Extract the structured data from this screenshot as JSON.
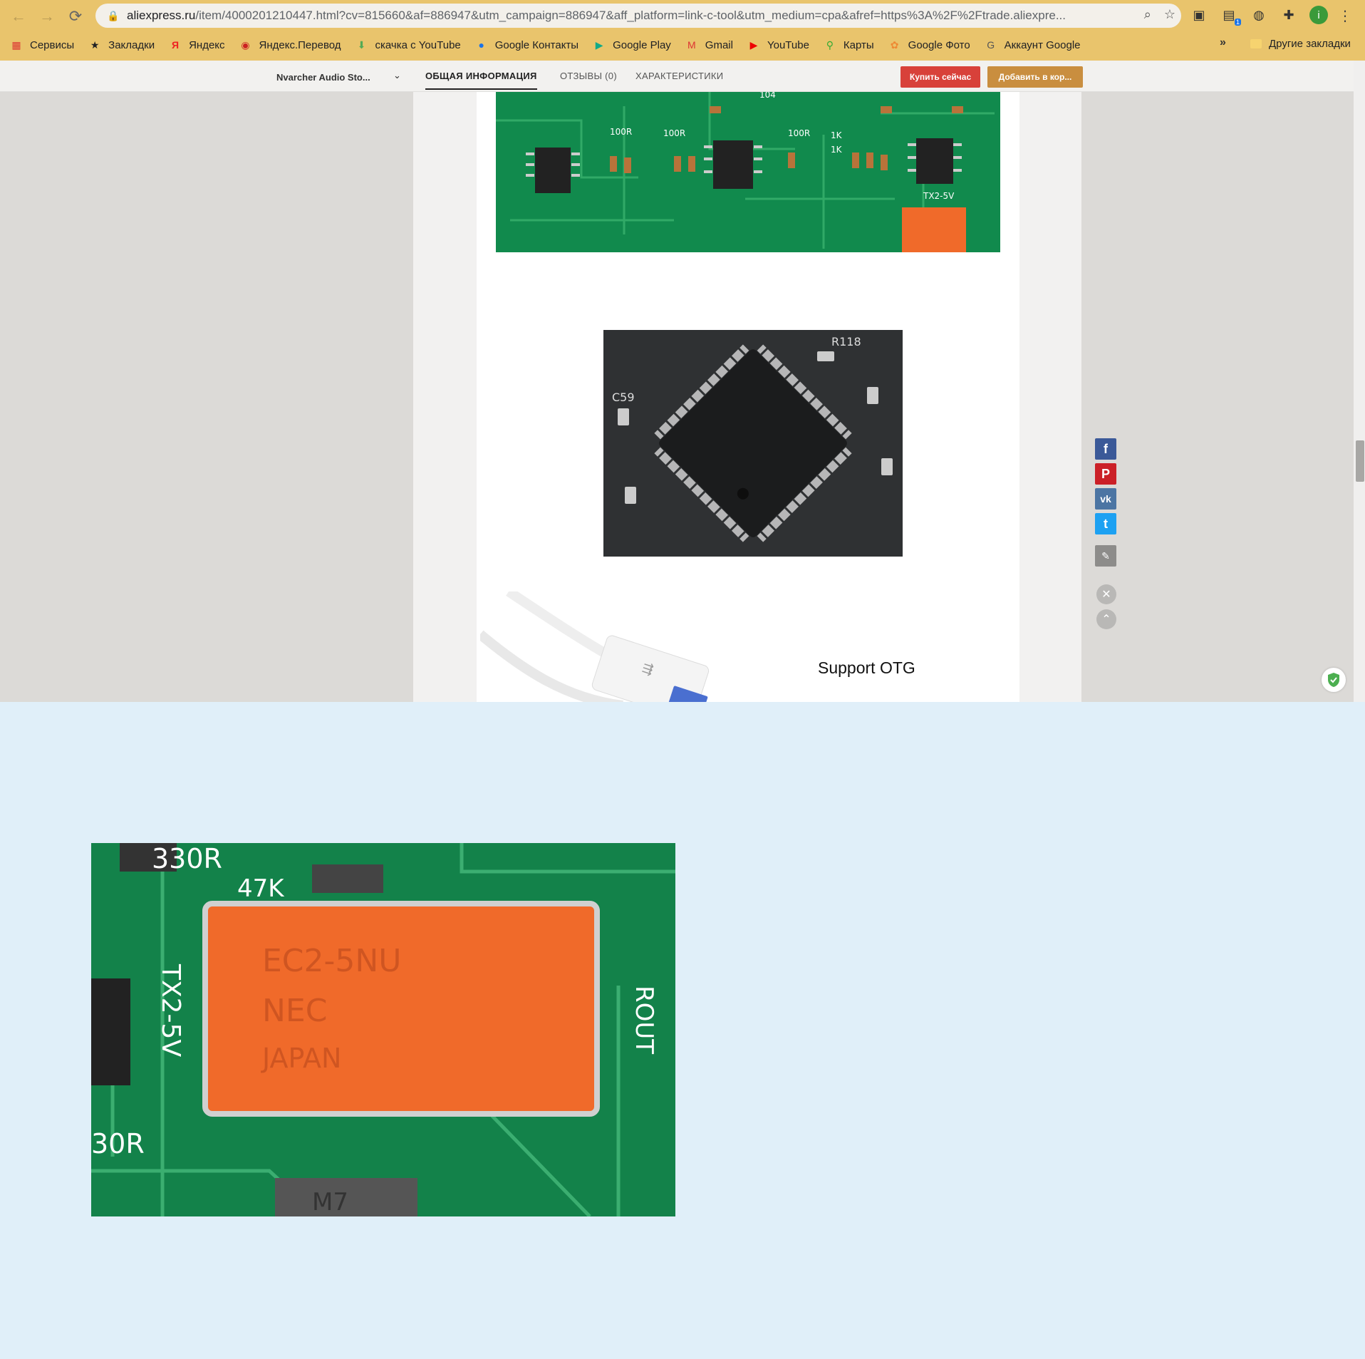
{
  "browser": {
    "url_host": "aliexpress.ru",
    "url_rest": "/item/4000201210447.html?cv=815660&af=886947&utm_campaign=886947&aff_platform=link-c-tool&utm_medium=cpa&afref=https%3A%2F%2Ftrade.aliexpre...",
    "extension_badge": "1",
    "avatar_letter": "i",
    "bookmarks": [
      {
        "label": "Сервисы",
        "icon": "apps-grid-icon"
      },
      {
        "label": "Закладки",
        "icon": "star-icon"
      },
      {
        "label": "Яндекс",
        "icon": "yandex-icon"
      },
      {
        "label": "Яндекс.Перевод",
        "icon": "translate-icon"
      },
      {
        "label": "скачка с YouTube",
        "icon": "download-icon"
      },
      {
        "label": "Google Контакты",
        "icon": "contacts-icon"
      },
      {
        "label": "Google Play",
        "icon": "play-icon"
      },
      {
        "label": "Gmail",
        "icon": "gmail-icon"
      },
      {
        "label": "YouTube",
        "icon": "youtube-icon"
      },
      {
        "label": "Карты",
        "icon": "maps-icon"
      },
      {
        "label": "Google Фото",
        "icon": "photos-icon"
      },
      {
        "label": "Аккаунт Google",
        "icon": "google-icon"
      }
    ],
    "more_label": "»",
    "other_bookmarks": "Другие закладки"
  },
  "product_nav": {
    "store_name": "Nvarcher Audio Sto...",
    "tabs": [
      "ОБЩАЯ ИНФОРМАЦИЯ",
      "ОТЗЫВЫ (0)",
      "ХАРАКТЕРИСТИКИ"
    ],
    "buy_now": "Купить сейчас",
    "add_to_cart": "Добавить в кор..."
  },
  "content": {
    "otg_caption": "Support OTG",
    "pcb_labels": [
      "100R",
      "100R",
      "100R",
      "104",
      "1K",
      "1K",
      "TX2-5V"
    ],
    "chip_labels": [
      "C59",
      "R118"
    ],
    "relay_text": [
      "EC2-5NU",
      "NEC",
      "JAPAN"
    ],
    "zoom_labels": [
      "330R",
      "47K",
      "TX2-5V",
      "ROUT",
      "30R",
      "M7"
    ]
  },
  "colors": {
    "bookmark_bar": "#e9c46c",
    "buy_button": "#d8413a",
    "cart_button": "#c98e3f",
    "pcb_green": "#118a4d",
    "relay_orange": "#f06a2a",
    "facebook": "#3b5998",
    "pinterest": "#cb2027",
    "vk": "#4c75a3",
    "twitter": "#1da1f2"
  }
}
